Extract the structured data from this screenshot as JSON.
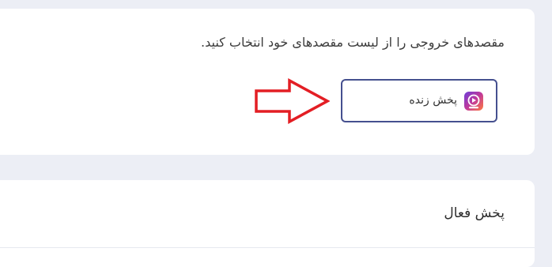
{
  "output_destinations": {
    "instruction": "مقصدهای خروجی را از لیست مقصدهای خود انتخاب کنید.",
    "options": [
      {
        "label": "پخش زنده",
        "icon": "live-stream-icon"
      }
    ],
    "annotation_icon": "red-arrow-icon"
  },
  "active_streams": {
    "title": "پخش فعال"
  },
  "colors": {
    "page_background": "#eceef5",
    "card_background": "#ffffff",
    "selected_border": "#45508f",
    "annotation_red": "#e31e24"
  }
}
